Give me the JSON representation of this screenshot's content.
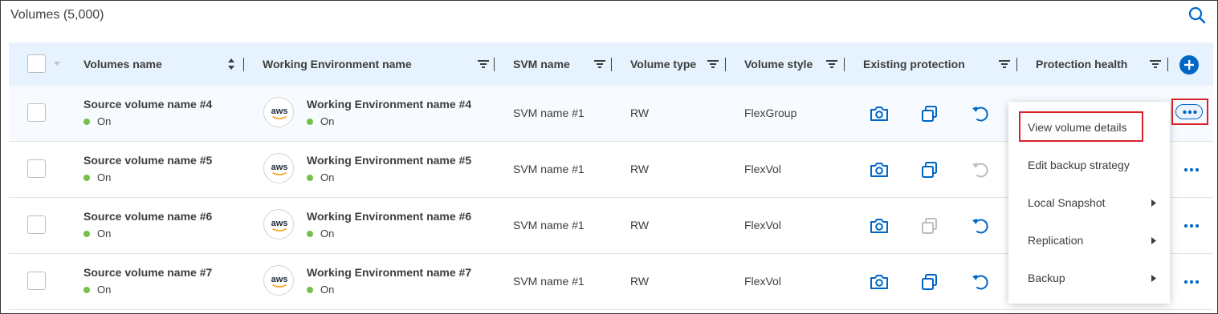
{
  "header": {
    "title": "Volumes (5,000)",
    "search_icon": "search-icon"
  },
  "columns": {
    "volumes_name": "Volumes name",
    "working_env": "Working Environment name",
    "svm": "SVM name",
    "volume_type": "Volume type",
    "volume_style": "Volume style",
    "existing_protection": "Existing protection",
    "protection_health": "Protection health"
  },
  "rows": [
    {
      "volume": "Source volume name #4",
      "volume_status": "On",
      "we_logo": "aws",
      "we": "Working Environment name  #4",
      "we_status": "On",
      "svm": "SVM name #1",
      "type": "RW",
      "style": "FlexGroup",
      "snapshot_active": true,
      "replication_active": true,
      "backup_active": true
    },
    {
      "volume": "Source volume name #5",
      "volume_status": "On",
      "we_logo": "aws",
      "we": "Working Environment name  #5",
      "we_status": "On",
      "svm": "SVM name #1",
      "type": "RW",
      "style": "FlexVol",
      "snapshot_active": true,
      "replication_active": true,
      "backup_active": false
    },
    {
      "volume": "Source volume name #6",
      "volume_status": "On",
      "we_logo": "aws",
      "we": "Working Environment name  #6",
      "we_status": "On",
      "svm": "SVM name #1",
      "type": "RW",
      "style": "FlexVol",
      "snapshot_active": true,
      "replication_active": false,
      "backup_active": true
    },
    {
      "volume": "Source volume name #7",
      "volume_status": "On",
      "we_logo": "aws",
      "we": "Working Environment name  #7",
      "we_status": "On",
      "svm": "SVM name #1",
      "type": "RW",
      "style": "FlexVol",
      "snapshot_active": true,
      "replication_active": true,
      "backup_active": true
    }
  ],
  "menu": {
    "items": [
      {
        "label": "View volume details",
        "submenu": false,
        "highlighted": true
      },
      {
        "label": "Edit backup strategy",
        "submenu": false,
        "highlighted": false
      },
      {
        "label": "Local Snapshot",
        "submenu": true,
        "highlighted": false
      },
      {
        "label": "Replication",
        "submenu": true,
        "highlighted": false
      },
      {
        "label": "Backup",
        "submenu": true,
        "highlighted": false
      }
    ]
  },
  "colors": {
    "accent": "#0067c5",
    "header_bg": "#e6f2fd",
    "status_on": "#74c04b",
    "highlight": "#d9212a",
    "inactive_icon": "#bdbdbd"
  }
}
